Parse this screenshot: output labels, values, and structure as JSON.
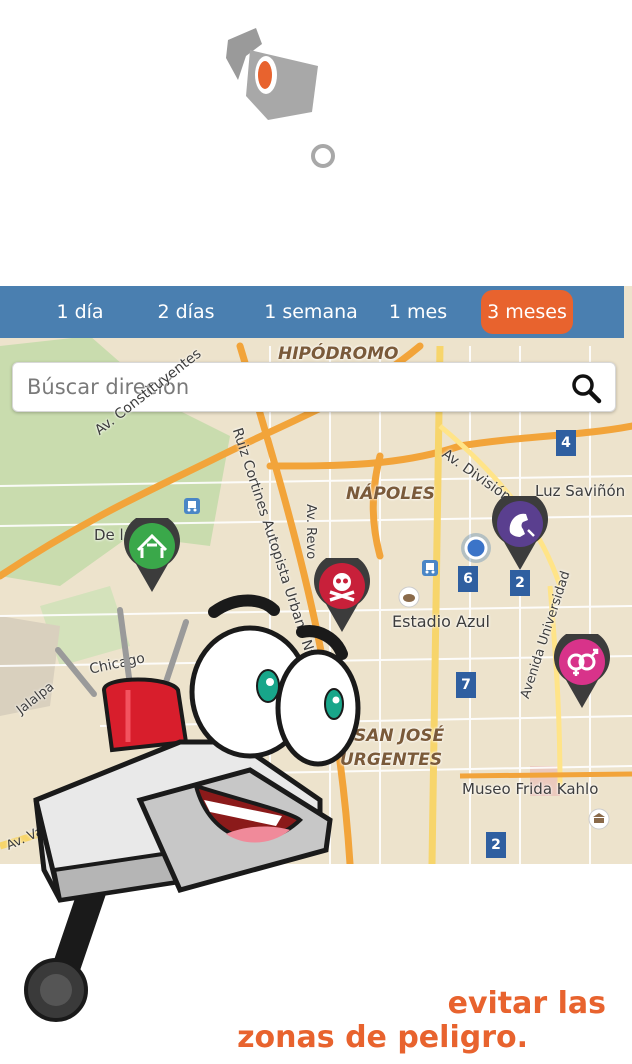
{
  "filters": {
    "tabs": [
      {
        "label": "1 día"
      },
      {
        "label": "2 días"
      },
      {
        "label": "1 semana"
      },
      {
        "label": "1 mes"
      },
      {
        "label": "3 meses"
      }
    ],
    "active_index": 4
  },
  "search": {
    "placeholder": "Búscar direción"
  },
  "map": {
    "labels": {
      "hipodromo": "HIPÓDROMO",
      "napoles": "NÁPOLES",
      "av_constituyentes": "Av. Constituyentes",
      "av_division": "Av. División",
      "luz_savinon": "Luz Saviñón",
      "de_las": "De las",
      "av_revolucion": "Av. Revo",
      "ruiz_cortines": "Ruiz Cortines Autopista Urbana Nte",
      "estadio_azul": "Estadio Azul",
      "chicago": "Chicago",
      "jalalpa": "Jalalpa",
      "san_jose": "SAN JOSÉ",
      "urgentes": "URGENTES",
      "museo_frida": "Museo Frida Kahlo",
      "avenida_univ": "Avenida Universidad",
      "av_vas": "Av. Vas"
    },
    "badges": [
      "4",
      "6",
      "2",
      "7",
      "2"
    ]
  },
  "tagline": {
    "line1": "evitar las",
    "line2": "zonas de peligro."
  },
  "colors": {
    "accent": "#e8632e",
    "bar": "#4a7fb0",
    "badge": "#2f5fa0",
    "pin_green": "#3aa84a",
    "pin_red": "#c8203a",
    "pin_purple": "#5a3f8f",
    "pin_pink": "#d8338a"
  },
  "icons": {
    "logo": "security-camera-logo-icon",
    "search": "search-icon",
    "pin_robbery_house": "house-robbery-pin-icon",
    "pin_death": "skull-pin-icon",
    "pin_phone": "phone-pin-icon",
    "pin_gender": "gender-pin-icon",
    "bus": "bus-stop-icon",
    "museum": "museum-icon"
  }
}
